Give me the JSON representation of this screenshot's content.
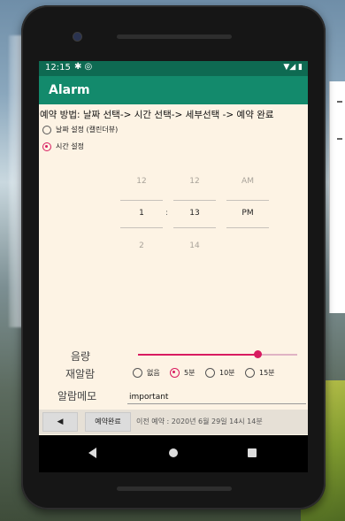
{
  "status_bar": {
    "time": "12:15",
    "left_icons": "✱ ◎",
    "right_icons": "▼◢ ▮"
  },
  "app_bar": {
    "title": "Alarm"
  },
  "instructions": "예약 방법: 날짜 선택-> 시간 선택-> 세부선택 -> 예약 완료",
  "mode_options": [
    {
      "label": "날짜 설정 (캘린더뷰)",
      "selected": false
    },
    {
      "label": "시간 설정",
      "selected": true
    }
  ],
  "time_picker": {
    "hour": {
      "above": "12",
      "selected": "1",
      "below": "2"
    },
    "minute": {
      "above": "12",
      "selected": "13",
      "below": "14"
    },
    "ampm": {
      "above": "AM",
      "selected": "PM",
      "below": ""
    },
    "separator": ":"
  },
  "volume": {
    "label": "음량",
    "level_percent": 75
  },
  "snooze": {
    "label": "재알람",
    "options": [
      {
        "label": "없음",
        "selected": false
      },
      {
        "label": "5분",
        "selected": true
      },
      {
        "label": "10분",
        "selected": false
      },
      {
        "label": "15분",
        "selected": false
      }
    ]
  },
  "memo": {
    "label": "알람메모",
    "value": "important"
  },
  "bottom_bar": {
    "back_label": "◀",
    "reserve_label": "예약완료",
    "previous_reservation": "이전 예약 : 2020년 6월 29일 14시 14분"
  },
  "colors": {
    "status_bar": "#0e6a52",
    "app_bar": "#138a6c",
    "accent": "#d81b60",
    "screen_bg": "#fdf3e4"
  },
  "icons": {
    "nav_back": "back-triangle-icon",
    "nav_home": "home-circle-icon",
    "nav_recent": "recent-square-icon"
  }
}
